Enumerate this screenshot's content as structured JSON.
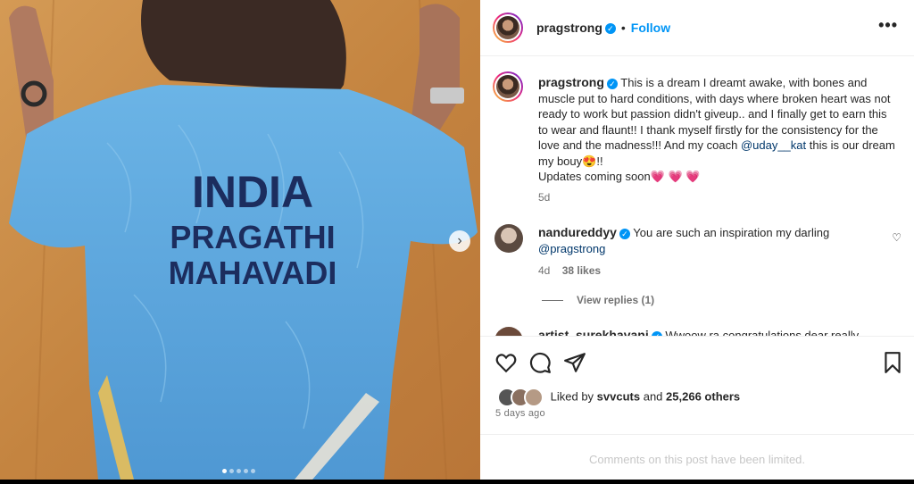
{
  "post": {
    "username": "pragstrong",
    "follow_label": "Follow",
    "dot": "•",
    "more_label": "•••",
    "jacket": {
      "line1": "INDIA",
      "line2": "PRAGATHI",
      "line3": "MAHAVADI"
    },
    "carousel": {
      "slides": 5,
      "active": 0,
      "next_label": "›"
    }
  },
  "caption": {
    "username": "pragstrong",
    "text": "This is a dream I dreamt awake, with bones and muscle put to hard conditions, with days where broken heart was not ready to work but passion didn't giveup.. and I finally get to earn this to wear and flaunt!! I thank myself firstly for the consistency for the love and the madness!!! And my coach",
    "mention": "@uday__kat",
    "text_after": " this is our dream my bouy",
    "emoji_1": "😍",
    "text_end": "!!",
    "updates": "Updates coming soon",
    "hearts": "💗 💗 💗",
    "age": "5d"
  },
  "comments": [
    {
      "username": "nandureddyy",
      "text": "You are such an inspiration my darling",
      "mention": "@pragstrong",
      "age": "4d",
      "likes": "38 likes",
      "view_replies": "View replies (1)"
    },
    {
      "username": "artist_surekhavani",
      "text": "Wwoow ra congratulations dear really"
    }
  ],
  "actions": {
    "liked_by_prefix": "Liked by",
    "liked_by_user": "svvcuts",
    "and": "and",
    "others": "25,266 others",
    "time": "5 days ago"
  },
  "footer": {
    "limited": "Comments on this post have been limited."
  },
  "colors": {
    "accent": "#0095f6",
    "jacket": "#5aa6dc",
    "wall": "#c98a45"
  }
}
